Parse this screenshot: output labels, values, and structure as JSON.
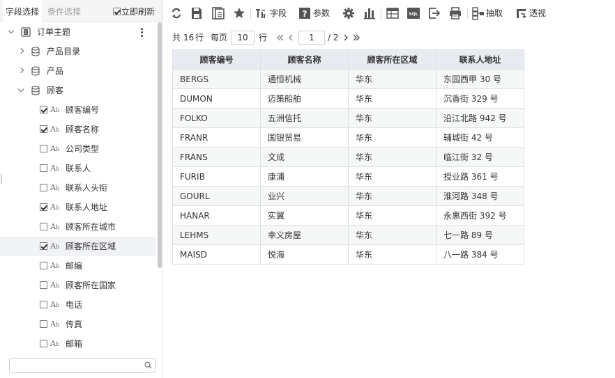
{
  "left_panel": {
    "tabs": [
      {
        "label": "字段选择"
      },
      {
        "label": "条件选择"
      }
    ],
    "auto_refresh": {
      "label": "立即刷新",
      "checked": true
    },
    "tree": {
      "root": {
        "label": "订单主题",
        "expanded": true
      },
      "groups": [
        {
          "label": "产品目录",
          "expanded": false
        },
        {
          "label": "产品",
          "expanded": false
        },
        {
          "label": "顾客",
          "expanded": true
        }
      ],
      "fields": [
        {
          "label": "顾客编号",
          "checked": true
        },
        {
          "label": "顾客名称",
          "checked": true
        },
        {
          "label": "公司类型",
          "checked": false
        },
        {
          "label": "联系人",
          "checked": false
        },
        {
          "label": "联系人头衔",
          "checked": false
        },
        {
          "label": "联系人地址",
          "checked": true
        },
        {
          "label": "顾客所在城市",
          "checked": false
        },
        {
          "label": "顾客所在区域",
          "checked": true
        },
        {
          "label": "邮编",
          "checked": false
        },
        {
          "label": "顾客所在国家",
          "checked": false
        },
        {
          "label": "电话",
          "checked": false
        },
        {
          "label": "传真",
          "checked": false
        },
        {
          "label": "邮箱",
          "checked": false
        }
      ],
      "field_type_icon": {
        "main": "A",
        "sub": "b"
      }
    },
    "search": {
      "placeholder": "",
      "value": ""
    }
  },
  "toolbar": {
    "field_label": "字段",
    "param_label": "参数",
    "extract_label": "抽取",
    "pivot_label": "透视",
    "sql_label": "SQL",
    "icons": [
      "refresh-icon",
      "save-icon",
      "save-as-icon",
      "star-icon",
      "field-icon",
      "param-icon",
      "settings-icon",
      "chart-icon",
      "table-icon",
      "sql-icon",
      "export-icon",
      "print-icon",
      "extract-icon",
      "pivot-icon"
    ]
  },
  "pager": {
    "total_prefix": "共",
    "total": "16",
    "total_suffix": "行",
    "per_page_label": "每页",
    "page_size": "10",
    "rows_label": "行",
    "current_page": "1",
    "total_pages": "/ 2"
  },
  "table": {
    "headers": [
      "顾客编号",
      "顾客名称",
      "顾客所在区域",
      "联系人地址"
    ],
    "rows": [
      [
        "BERGS",
        "通恒机械",
        "华东",
        "东园西甲 30 号"
      ],
      [
        "DUMON",
        "迈策船舶",
        "华东",
        "沉香街 329 号"
      ],
      [
        "FOLKO",
        "五洲信托",
        "华东",
        "沿江北路 942 号"
      ],
      [
        "FRANR",
        "国银贸易",
        "华东",
        "辅城街 42 号"
      ],
      [
        "FRANS",
        "文成",
        "华东",
        "临江街 32 号"
      ],
      [
        "FURIB",
        "康浦",
        "华东",
        "授业路 361 号"
      ],
      [
        "GOURL",
        "业兴",
        "华东",
        "淮河路 348 号"
      ],
      [
        "HANAR",
        "实翼",
        "华东",
        "永惠西街 392 号"
      ],
      [
        "LEHMS",
        "幸义房屋",
        "华东",
        "七一路 89 号"
      ],
      [
        "MAISD",
        "悦海",
        "华东",
        "八一路 384 号"
      ]
    ]
  },
  "colors": {
    "header_bg": "#e8ebef",
    "odd_row_bg": "#f6f8f8",
    "border": "#dde0e4",
    "icon": "#555555"
  }
}
